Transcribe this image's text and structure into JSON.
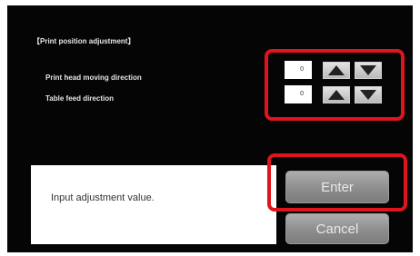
{
  "screen": {
    "title": "【Print position adjustment】",
    "rows": [
      {
        "label": "Print head moving direction",
        "value": "0"
      },
      {
        "label": "Table feed direction",
        "value": "0"
      }
    ],
    "message": "Input adjustment value.",
    "buttons": {
      "enter": "Enter",
      "cancel": "Cancel"
    }
  },
  "icons": {
    "up": "up-triangle-icon",
    "down": "down-triangle-icon"
  },
  "colors": {
    "background": "#050505",
    "highlight": "#e0141c",
    "button_gray": "#8d8d8d",
    "panel": "#ffffff"
  }
}
